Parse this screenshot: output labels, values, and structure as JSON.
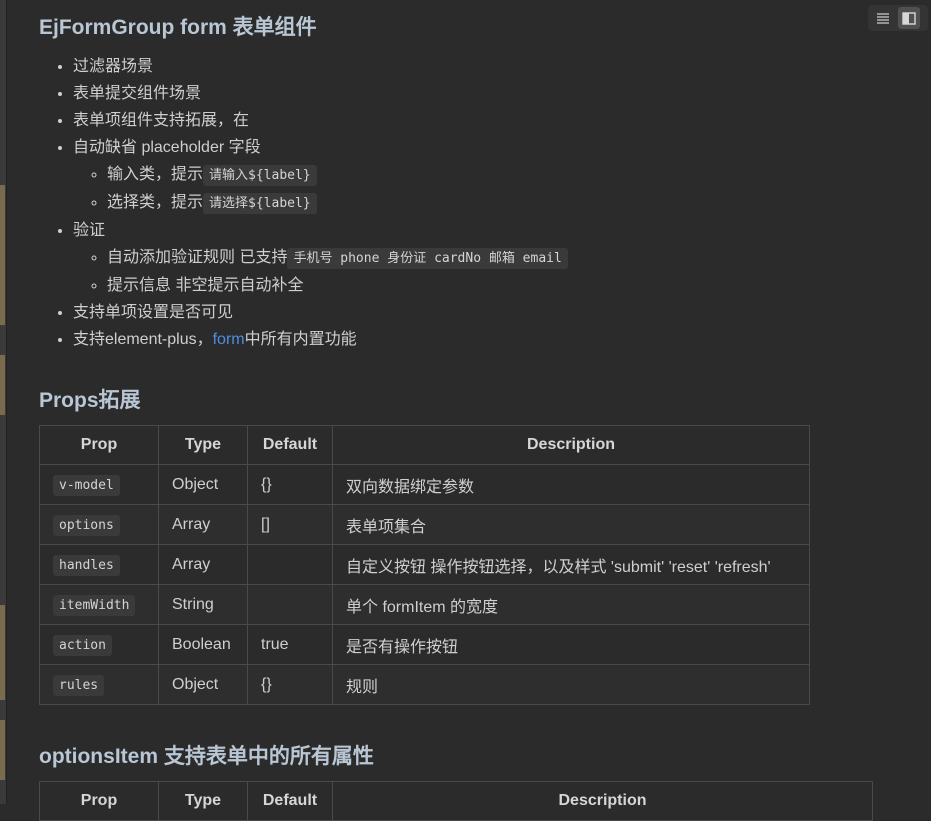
{
  "heading1": "EjFormGroup form 表单组件",
  "features": {
    "item1": "过滤器场景",
    "item2": "表单提交组件场景",
    "item3": "表单项组件支持拓展，在",
    "item4": "自动缺省 placeholder 字段",
    "item4_sub1_text": "输入类，提示",
    "item4_sub1_code": "请输入${label}",
    "item4_sub2_text": "选择类，提示",
    "item4_sub2_code": "请选择${label}",
    "item5": "验证",
    "item5_sub1_text": "自动添加验证规则 已支持",
    "item5_sub1_code": "手机号 phone 身份证 cardNo 邮箱 email",
    "item5_sub2": "提示信息 非空提示自动补全",
    "item6": "支持单项设置是否可见",
    "item7_prefix": "支持element-plus，",
    "item7_link": "form",
    "item7_suffix": "中所有内置功能"
  },
  "heading2": "Props拓展",
  "props_table": {
    "headers": [
      "Prop",
      "Type",
      "Default",
      "Description"
    ],
    "rows": [
      {
        "prop": "v-model",
        "type": "Object",
        "default": "{}",
        "desc": "双向数据绑定参数"
      },
      {
        "prop": "options",
        "type": "Array",
        "default": "[]",
        "desc": "表单项集合"
      },
      {
        "prop": "handles",
        "type": "Array",
        "default": "",
        "desc": "自定义按钮 操作按钮选择，以及样式 'submit' 'reset' 'refresh'"
      },
      {
        "prop": "itemWidth",
        "type": "String",
        "default": "",
        "desc": "单个 formItem 的宽度"
      },
      {
        "prop": "action",
        "type": "Boolean",
        "default": "true",
        "desc": "是否有操作按钮"
      },
      {
        "prop": "rules",
        "type": "Object",
        "default": "{}",
        "desc": "规则"
      }
    ]
  },
  "heading3": "optionsItem 支持表单中的所有属性",
  "options_table": {
    "headers": [
      "Prop",
      "Type",
      "Default",
      "Description"
    ]
  },
  "toolbar": {
    "icons": [
      "list-view-icon",
      "split-view-icon"
    ]
  },
  "colors": {
    "background": "#2b2b2b",
    "heading": "#b9c6d4",
    "link": "#4c8fe0",
    "code_bg": "#3a3a3a"
  }
}
